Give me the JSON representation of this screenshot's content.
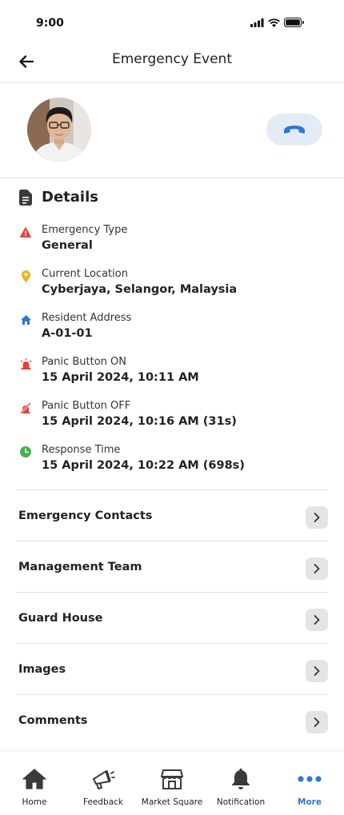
{
  "status_bar": {
    "time": "9:00"
  },
  "header": {
    "title": "Emergency Event"
  },
  "details": {
    "title": "Details",
    "items": [
      {
        "label": "Emergency Type",
        "value": "General",
        "icon": "warning-icon",
        "color": "#e0443a"
      },
      {
        "label": "Current Location",
        "value": "Cyberjaya, Selangor, Malaysia",
        "icon": "location-pin-icon",
        "color": "#f2b01e"
      },
      {
        "label": "Resident Address",
        "value": "A-01-01",
        "icon": "home-icon",
        "color": "#2b79d6"
      },
      {
        "label": "Panic Button ON",
        "value": "15 April 2024, 10:11 AM",
        "icon": "siren-icon",
        "color": "#e0443a"
      },
      {
        "label": "Panic Button OFF",
        "value": "15 April 2024, 10:16 AM (31s)",
        "icon": "siren-off-icon",
        "color": "#e0443a"
      },
      {
        "label": "Response Time",
        "value": "15 April 2024, 10:22 AM (698s)",
        "icon": "clock-icon",
        "color": "#43b34a"
      }
    ]
  },
  "sections": [
    {
      "label": "Emergency Contacts"
    },
    {
      "label": "Management Team"
    },
    {
      "label": "Guard House"
    },
    {
      "label": "Images"
    },
    {
      "label": "Comments"
    }
  ],
  "nav": {
    "items": [
      {
        "label": "Home",
        "icon": "home-icon",
        "active": false
      },
      {
        "label": "Feedback",
        "icon": "megaphone-icon",
        "active": false
      },
      {
        "label": "Market Square",
        "icon": "store-icon",
        "active": false
      },
      {
        "label": "Notification",
        "icon": "bell-icon",
        "active": false
      },
      {
        "label": "More",
        "icon": "more-dots-icon",
        "active": true
      }
    ]
  },
  "colors": {
    "accent": "#2b79d6",
    "call_button_bg": "#e3ebf5",
    "alert": "#e0443a"
  }
}
